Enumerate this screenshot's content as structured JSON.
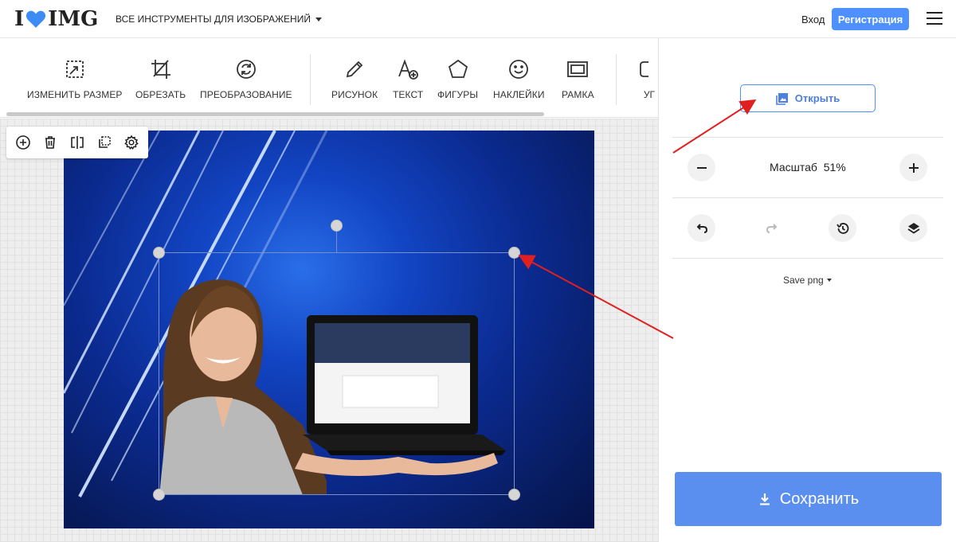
{
  "header": {
    "brand_letters_left": "I",
    "brand_letters_right": "IMG",
    "all_tools_label": "ВСЕ ИНСТРУМЕНТЫ ДЛЯ ИЗОБРАЖЕНИЙ",
    "login_label": "Вход",
    "register_label": "Регистрация",
    "accent_color": "#4d90fe",
    "heart_color": "#3d8cf5"
  },
  "toolbar": {
    "tools": [
      {
        "label": "ИЗМЕНИТЬ РАЗМЕР",
        "icon": "resize-icon"
      },
      {
        "label": "ОБРЕЗАТЬ",
        "icon": "crop-icon"
      },
      {
        "label": "ПРЕОБРАЗОВАНИЕ",
        "icon": "rotate-icon"
      },
      {
        "label": "РИСУНОК",
        "icon": "pencil-icon"
      },
      {
        "label": "ТЕКСТ",
        "icon": "text-add-icon"
      },
      {
        "label": "ФИГУРЫ",
        "icon": "shapes-icon"
      },
      {
        "label": "НАКЛЕЙКИ",
        "icon": "smiley-icon"
      },
      {
        "label": "РАМКА",
        "icon": "frame-icon"
      },
      {
        "label": "УГ",
        "icon": "corners-icon"
      }
    ]
  },
  "layer_toolbar": {
    "buttons": [
      "add-layer-icon",
      "trash-icon",
      "flip-icon",
      "duplicate-icon",
      "settings-icon"
    ]
  },
  "right_panel": {
    "open_label": "Открыть",
    "zoom_label": "Масштаб",
    "zoom_value": "51%",
    "save_format_label": "Save png",
    "save_label": "Сохранить",
    "save_color": "#5b8fef"
  },
  "canvas": {
    "background_colors": [
      "#2a6ee8",
      "#0b2a8f",
      "#05124a"
    ],
    "annotation_arrow_color": "#e02020"
  }
}
